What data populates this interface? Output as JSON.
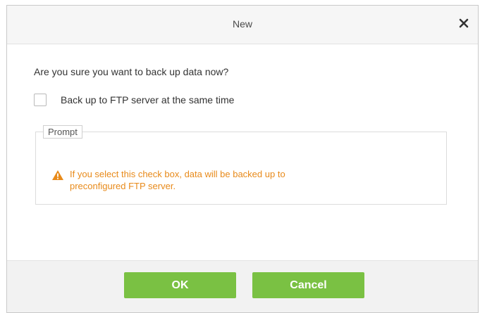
{
  "dialog": {
    "title": "New",
    "close_icon": "close-icon",
    "question": "Are you sure you want to back up data now?",
    "ftp_checkbox": {
      "label": "Back up to FTP server at the same time",
      "checked": false
    },
    "prompt": {
      "legend": "Prompt",
      "icon": "warning-icon",
      "message_line1": "If you select this check box, data will be backed up to",
      "message_line2": "preconfigured FTP server."
    },
    "buttons": {
      "ok": "OK",
      "cancel": "Cancel"
    }
  },
  "colors": {
    "accent_green": "#7ac143",
    "warning_orange": "#e88a1a"
  }
}
